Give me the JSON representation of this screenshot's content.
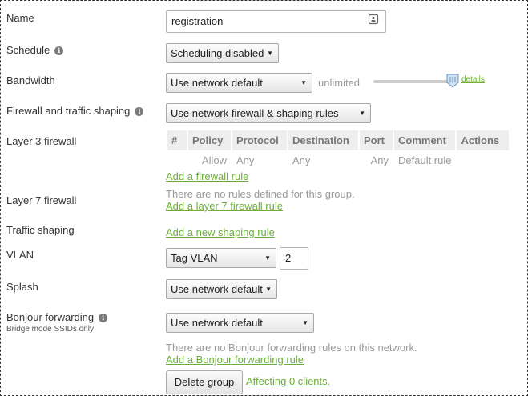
{
  "name": {
    "label": "Name",
    "value": "registration"
  },
  "schedule": {
    "label": "Schedule",
    "info_icon": "info-icon",
    "value": "Scheduling disabled"
  },
  "bandwidth": {
    "label": "Bandwidth",
    "value": "Use network default",
    "limit_text": "unlimited",
    "details_link": "details",
    "slider_level": 1.0
  },
  "firewall_shaping": {
    "label": "Firewall and traffic shaping",
    "info_icon": "info-icon",
    "value": "Use network firewall & shaping rules"
  },
  "layer3": {
    "label": "Layer 3 firewall",
    "columns": [
      "#",
      "Policy",
      "Protocol",
      "Destination",
      "Port",
      "Comment",
      "Actions"
    ],
    "rows": [
      [
        "",
        "Allow",
        "Any",
        "Any",
        "Any",
        "Default rule",
        ""
      ]
    ],
    "add_link": "Add a firewall rule"
  },
  "layer7": {
    "label": "Layer 7 firewall",
    "empty_text": "There are no rules defined for this group.",
    "add_link": "Add a layer 7 firewall rule"
  },
  "traffic_shaping": {
    "label": "Traffic shaping",
    "add_link": "Add a new shaping rule"
  },
  "vlan": {
    "label": "VLAN",
    "mode": "Tag VLAN",
    "value": "2"
  },
  "splash": {
    "label": "Splash",
    "value": "Use network default"
  },
  "bonjour": {
    "label": "Bonjour forwarding",
    "sublabel": "Bridge mode SSIDs only",
    "info_icon": "info-icon",
    "value": "Use network default",
    "empty_text": "There are no Bonjour forwarding rules on this network.",
    "add_link": "Add a Bonjour forwarding rule"
  },
  "footer": {
    "delete_button": "Delete group",
    "affecting_link": "Affecting 0 clients."
  },
  "colors": {
    "link": "#6cae3c",
    "muted": "#999999",
    "header_bg": "#eeeeee"
  }
}
